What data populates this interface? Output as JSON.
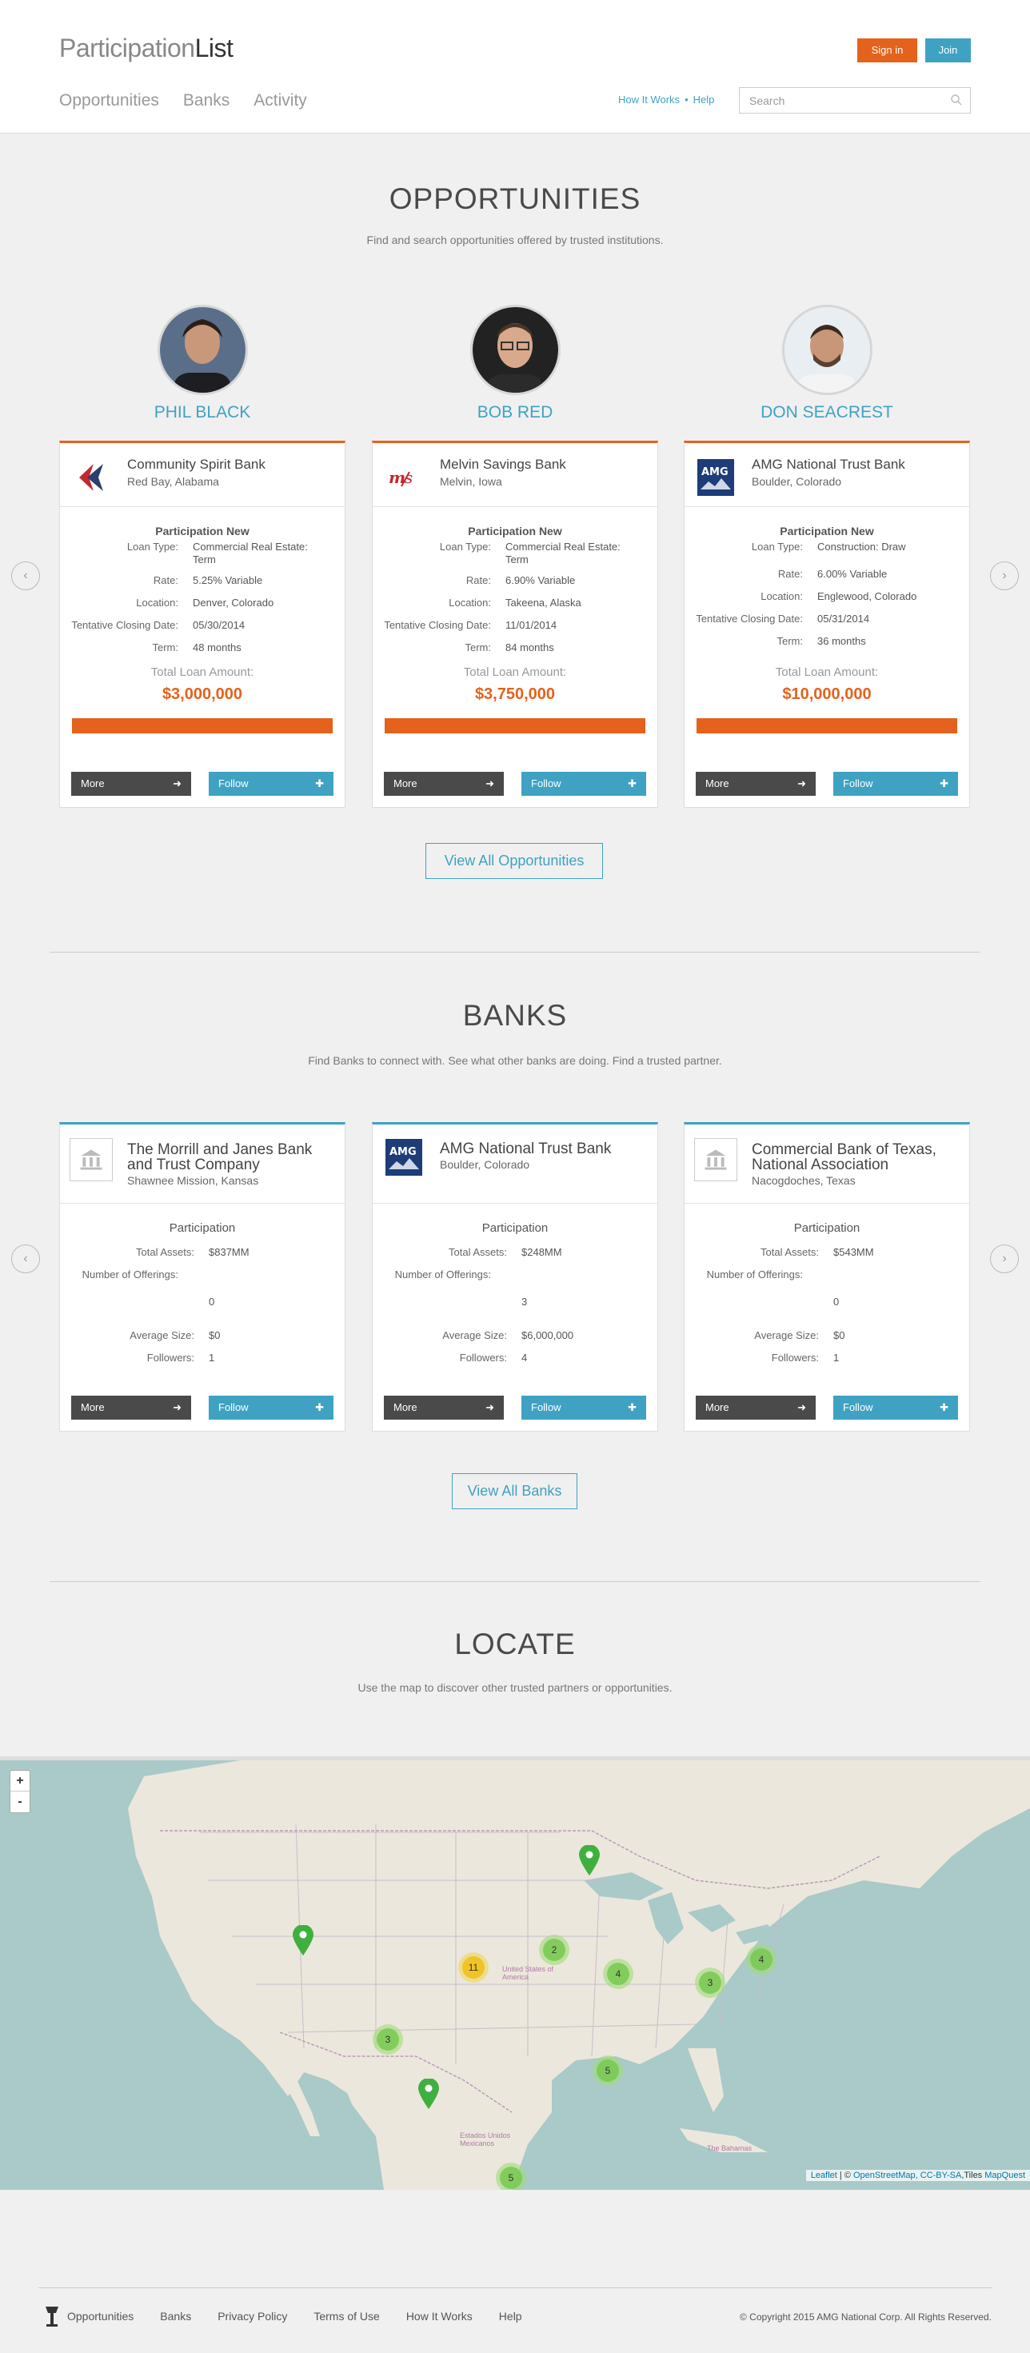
{
  "header": {
    "logo_light": "Participation",
    "logo_dark": "List",
    "signin_label": "Sign in",
    "join_label": "Join",
    "nav": [
      "Opportunities",
      "Banks",
      "Activity"
    ],
    "help_links": [
      "How It Works",
      "Help"
    ],
    "search_placeholder": "Search"
  },
  "opportunities": {
    "title": "OPPORTUNITIES",
    "subtitle": "Find and search opportunities offered by trusted institutions.",
    "people": [
      "PHIL BLACK",
      "BOB RED",
      "DON SEACREST"
    ],
    "cards": [
      {
        "bank": "Community Spirit Bank",
        "location": "Red Bay, Alabama",
        "section": "Participation New",
        "loan_type": "Commercial Real Estate: Term",
        "rate": "5.25% Variable",
        "loc": "Denver, Colorado",
        "closing": "05/30/2014",
        "term": "48 months",
        "total_label": "Total Loan Amount:",
        "total": "$3,000,000",
        "progress": 1.0
      },
      {
        "bank": "Melvin Savings Bank",
        "location": "Melvin, Iowa",
        "section": "Participation New",
        "loan_type": "Commercial Real Estate: Term",
        "rate": "6.90% Variable",
        "loc": "Takeena, Alaska",
        "closing": "11/01/2014",
        "term": "84 months",
        "total_label": "Total Loan Amount:",
        "total": "$3,750,000",
        "progress": 1.0
      },
      {
        "bank": "AMG National Trust Bank",
        "location": "Boulder, Colorado",
        "section": "Participation New",
        "loan_type": "Construction: Draw",
        "rate": "6.00% Variable",
        "loc": "Englewood, Colorado",
        "closing": "05/31/2014",
        "term": "36 months",
        "total_label": "Total Loan Amount:",
        "total": "$10,000,000",
        "progress": 1.0
      }
    ],
    "labels": {
      "loan_type": "Loan Type:",
      "rate": "Rate:",
      "location": "Location:",
      "closing": "Tentative Closing Date:",
      "term": "Term:"
    },
    "view_all": "View All Opportunities"
  },
  "banks": {
    "title": "BANKS",
    "subtitle": "Find Banks to connect with. See what other banks are doing. Find a trusted partner.",
    "cards": [
      {
        "name": "The Morrill and Janes Bank and Trust Company",
        "location": "Shawnee Mission, Kansas",
        "section": "Participation",
        "assets": "$837MM",
        "offerings": "0",
        "avg": "$0",
        "followers": "1"
      },
      {
        "name": "AMG National Trust Bank",
        "location": "Boulder, Colorado",
        "section": "Participation",
        "assets": "$248MM",
        "offerings": "3",
        "avg": "$6,000,000",
        "followers": "4"
      },
      {
        "name": "Commercial Bank of Texas, National Association",
        "location": "Nacogdoches, Texas",
        "section": "Participation",
        "assets": "$543MM",
        "offerings": "0",
        "avg": "$0",
        "followers": "1"
      }
    ],
    "labels": {
      "assets": "Total Assets:",
      "offerings": "Number of Offerings:",
      "avg": "Average Size:",
      "followers": "Followers:"
    },
    "view_all": "View All Banks"
  },
  "buttons": {
    "more": "More",
    "follow": "Follow"
  },
  "locate": {
    "title": "LOCATE",
    "subtitle": "Use the map to discover other trusted partners or opportunities.",
    "zoom_in": "+",
    "zoom_out": "-",
    "clusters": [
      "11",
      "2",
      "4",
      "3",
      "4",
      "3",
      "5",
      "5"
    ],
    "map_labels": [
      "United States of America",
      "Estados Unidos Mexicanos",
      "The Bahamas"
    ],
    "attribution_leaflet": "Leaflet",
    "attribution_sep": " | © ",
    "attribution_osm": "OpenStreetMap",
    "attribution_lic": ", CC-BY-SA",
    "attribution_tiles": ",Tiles ",
    "attribution_mq": "MapQuest"
  },
  "footer": {
    "links": [
      "Opportunities",
      "Banks",
      "Privacy Policy",
      "Terms of Use",
      "How It Works",
      "Help"
    ],
    "copyright": "© Copyright 2015 AMG National Corp. All Rights Reserved."
  },
  "colors": {
    "orange": "#e4621b",
    "blue": "#3fa2c2",
    "dark": "#4a4a4a"
  }
}
